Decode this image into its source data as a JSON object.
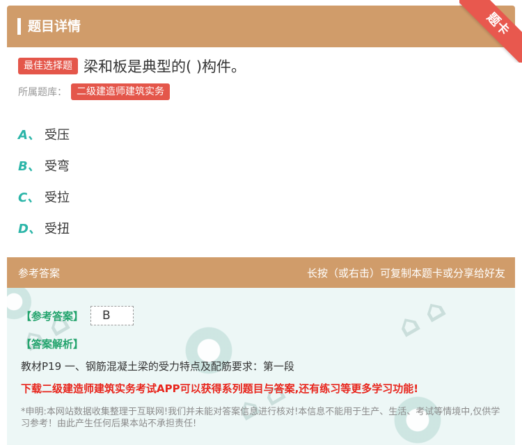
{
  "header": {
    "title": "题目详情",
    "ribbon": "题卡"
  },
  "question": {
    "tag": "最佳选择题",
    "text": "梁和板是典型的( )构件。"
  },
  "bank": {
    "label": "所属题库：",
    "value": "二级建造师建筑实务"
  },
  "options": [
    {
      "letter": "A、",
      "text": "受压"
    },
    {
      "letter": "B、",
      "text": "受弯"
    },
    {
      "letter": "C、",
      "text": "受拉"
    },
    {
      "letter": "D、",
      "text": "受扭"
    }
  ],
  "answer_header": {
    "left": "参考答案",
    "right": "长按（或右击）可复制本题卡或分享给好友"
  },
  "answer": {
    "label": "【参考答案】",
    "value": "B",
    "explanation_label": "【答案解析】",
    "explanation": "教材P19 一、钢筋混凝土梁的受力特点及配筋要求：第一段",
    "promo": "下载二级建造师建筑实务考试APP可以获得系列题目与答案,还有练习等更多学习功能!",
    "disclaimer": "*申明:本网站数据收集整理于互联网!我们并未能对答案信息进行核对!本信息不能用于生产、生活、考试等情境中,仅供学习参考！由此产生任何后果本站不承担责任!"
  },
  "colors": {
    "header": "#d09c6a",
    "tag": "#e4564a",
    "option_letter": "#2bb5a8",
    "answer_label": "#22a36c",
    "promo": "#e8251c",
    "ribbon": "#e8584e"
  }
}
